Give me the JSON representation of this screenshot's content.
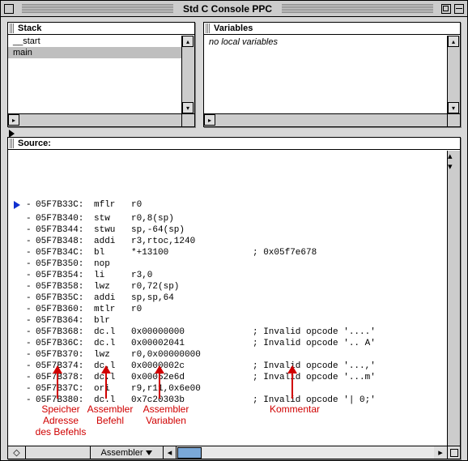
{
  "window": {
    "title": "Std C Console PPC"
  },
  "panels": {
    "stack": {
      "title": "Stack",
      "items": [
        "__start",
        "main"
      ],
      "selected_index": 1
    },
    "variables": {
      "title": "Variables",
      "empty_text": "no local variables"
    },
    "source": {
      "title": "Source:"
    }
  },
  "disassembly": [
    {
      "cur": true,
      "addr": "05F7B33C:",
      "mnm": "mflr",
      "ops": "r0",
      "cmt": ""
    },
    {
      "cur": false,
      "addr": "05F7B340:",
      "mnm": "stw",
      "ops": "r0,8(sp)",
      "cmt": ""
    },
    {
      "cur": false,
      "addr": "05F7B344:",
      "mnm": "stwu",
      "ops": "sp,-64(sp)",
      "cmt": ""
    },
    {
      "cur": false,
      "addr": "05F7B348:",
      "mnm": "addi",
      "ops": "r3,rtoc,1240",
      "cmt": ""
    },
    {
      "cur": false,
      "addr": "05F7B34C:",
      "mnm": "bl",
      "ops": "*+13100",
      "cmt": "; 0x05f7e678"
    },
    {
      "cur": false,
      "addr": "05F7B350:",
      "mnm": "nop",
      "ops": "",
      "cmt": ""
    },
    {
      "cur": false,
      "addr": "05F7B354:",
      "mnm": "li",
      "ops": "r3,0",
      "cmt": ""
    },
    {
      "cur": false,
      "addr": "05F7B358:",
      "mnm": "lwz",
      "ops": "r0,72(sp)",
      "cmt": ""
    },
    {
      "cur": false,
      "addr": "05F7B35C:",
      "mnm": "addi",
      "ops": "sp,sp,64",
      "cmt": ""
    },
    {
      "cur": false,
      "addr": "05F7B360:",
      "mnm": "mtlr",
      "ops": "r0",
      "cmt": ""
    },
    {
      "cur": false,
      "addr": "05F7B364:",
      "mnm": "blr",
      "ops": "",
      "cmt": ""
    },
    {
      "cur": false,
      "addr": "05F7B368:",
      "mnm": "dc.l",
      "ops": "0x00000000",
      "cmt": "; Invalid opcode '....'"
    },
    {
      "cur": false,
      "addr": "05F7B36C:",
      "mnm": "dc.l",
      "ops": "0x00002041",
      "cmt": "; Invalid opcode '.. A'"
    },
    {
      "cur": false,
      "addr": "05F7B370:",
      "mnm": "lwz",
      "ops": "r0,0x00000000",
      "cmt": ""
    },
    {
      "cur": false,
      "addr": "05F7B374:",
      "mnm": "dc.l",
      "ops": "0x0000002c",
      "cmt": "; Invalid opcode '...,'"
    },
    {
      "cur": false,
      "addr": "05F7B378:",
      "mnm": "dc.l",
      "ops": "0x00052e6d",
      "cmt": "; Invalid opcode '...m'"
    },
    {
      "cur": false,
      "addr": "05F7B37C:",
      "mnm": "ori",
      "ops": "r9,r11,0x6e00",
      "cmt": ""
    },
    {
      "cur": false,
      "addr": "05F7B380:",
      "mnm": "dc.l",
      "ops": "0x7c20303b",
      "cmt": "; Invalid opcode '| 0;'"
    }
  ],
  "annotations": {
    "addr_label": "Speicher\nAdresse\ndes Befehls",
    "mnm_label": "Assembler\nBefehl",
    "ops_label": "Assembler\nVariablen",
    "cmt_label": "Kommentar"
  },
  "bottombar": {
    "view_mode": "Assembler"
  }
}
